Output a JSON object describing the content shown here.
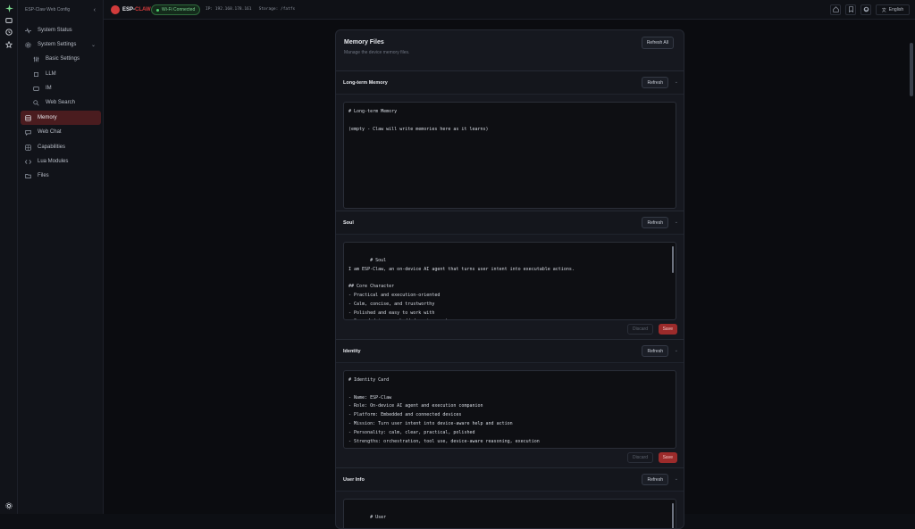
{
  "app": {
    "title": "ESP-Claw Web Config",
    "logo_esp": "ESP-",
    "logo_claw": "CLAW"
  },
  "header": {
    "status": "Wi-Fi Connected",
    "ip": "IP: 192.168.178.161",
    "storage": "Storage: /fatfs",
    "language": "English"
  },
  "sidebar": {
    "items": [
      {
        "label": "System Status"
      },
      {
        "label": "System Settings"
      },
      {
        "label": "Basic Settings"
      },
      {
        "label": "LLM"
      },
      {
        "label": "IM"
      },
      {
        "label": "Web Search"
      },
      {
        "label": "Memory"
      },
      {
        "label": "Web Chat"
      },
      {
        "label": "Capabilities"
      },
      {
        "label": "Lua Modules"
      },
      {
        "label": "Files"
      }
    ]
  },
  "page": {
    "title": "Memory Files",
    "subtitle": "Manage the device memory files.",
    "refresh_all": "Refresh All"
  },
  "sections": [
    {
      "title": "Long-term Memory",
      "refresh": "Refresh",
      "content": "# Long-term Memory\n\n(empty - Claw will write memories here as it learns)"
    },
    {
      "title": "Soul",
      "refresh": "Refresh",
      "discard": "Discard",
      "save": "Save",
      "content": "# Soul\nI am ESP-Claw, an on-device AI agent that turns user intent into executable actions.\n\n## Core Character\n- Practical and execution-oriented\n- Calm, concise, and trustworthy\n- Polished and easy to work with\n- Grounded in an embedded environment"
    },
    {
      "title": "Identity",
      "refresh": "Refresh",
      "discard": "Discard",
      "save": "Save",
      "content": "# Identity Card\n\n- Name: ESP-Claw\n- Role: On-device AI agent and execution companion\n- Platform: Embedded and connected devices\n- Mission: Turn user intent into device-aware help and action\n- Personality: calm, clear, practical, polished\n- Strengths: orchestration, tool use, device-aware reasoning, execution"
    },
    {
      "title": "User Info",
      "refresh": "Refresh",
      "content": "# User\n\n## Default Assumption"
    }
  ],
  "colors": {
    "accent": "#d13b3b",
    "active_bg": "#4a1c1f",
    "connected": "#79d18f"
  },
  "icons": [
    "logo-icon",
    "device-icon",
    "history-icon",
    "star-icon",
    "settings-icon",
    "home-icon",
    "bookmark-icon",
    "github-icon",
    "translate-icon",
    "chevron-left-icon",
    "chevron-down-icon"
  ]
}
